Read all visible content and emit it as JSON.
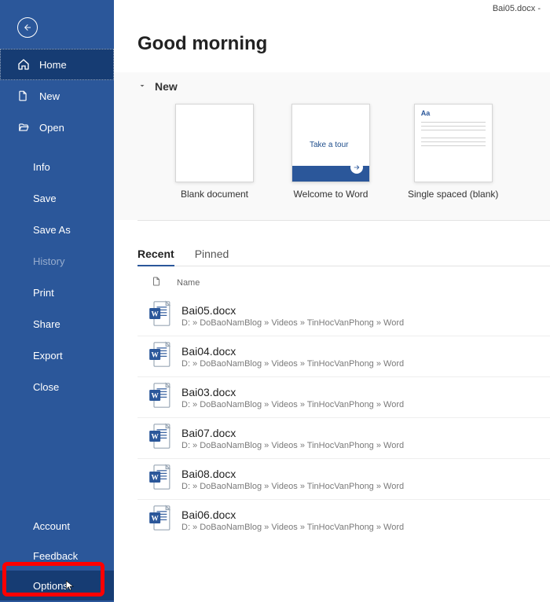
{
  "titlebar": "Bai05.docx -",
  "greeting": "Good morning",
  "new_section_label": "New",
  "sidebar": {
    "primary": [
      {
        "key": "home",
        "label": "Home",
        "icon": "home-icon",
        "active": true
      },
      {
        "key": "new",
        "label": "New",
        "icon": "page-icon"
      },
      {
        "key": "open",
        "label": "Open",
        "icon": "folder-icon"
      }
    ],
    "secondary": [
      {
        "key": "info",
        "label": "Info"
      },
      {
        "key": "save",
        "label": "Save"
      },
      {
        "key": "saveas",
        "label": "Save As"
      },
      {
        "key": "history",
        "label": "History",
        "dim": true
      },
      {
        "key": "print",
        "label": "Print"
      },
      {
        "key": "share",
        "label": "Share"
      },
      {
        "key": "export",
        "label": "Export"
      },
      {
        "key": "close",
        "label": "Close"
      }
    ],
    "bottom": [
      {
        "key": "account",
        "label": "Account"
      },
      {
        "key": "feedback",
        "label": "Feedback"
      },
      {
        "key": "options",
        "label": "Options",
        "highlighted": true
      }
    ]
  },
  "templates": [
    {
      "key": "blank",
      "label": "Blank document",
      "thumb": "blank"
    },
    {
      "key": "welcome",
      "label": "Welcome to Word",
      "thumb": "tour",
      "tour_text": "Take a tour"
    },
    {
      "key": "single",
      "label": "Single spaced (blank)",
      "thumb": "single",
      "thumb_text": "Aa"
    }
  ],
  "tabs": [
    {
      "key": "recent",
      "label": "Recent",
      "active": true
    },
    {
      "key": "pinned",
      "label": "Pinned"
    }
  ],
  "list_header": {
    "name_label": "Name"
  },
  "recent_files": [
    {
      "name": "Bai05.docx",
      "path": "D: » DoBaoNamBlog » Videos » TinHocVanPhong » Word"
    },
    {
      "name": "Bai04.docx",
      "path": "D: » DoBaoNamBlog » Videos » TinHocVanPhong » Word"
    },
    {
      "name": "Bai03.docx",
      "path": "D: » DoBaoNamBlog » Videos » TinHocVanPhong » Word"
    },
    {
      "name": "Bai07.docx",
      "path": "D: » DoBaoNamBlog » Videos » TinHocVanPhong » Word"
    },
    {
      "name": "Bai08.docx",
      "path": "D: » DoBaoNamBlog » Videos » TinHocVanPhong » Word"
    },
    {
      "name": "Bai06.docx",
      "path": "D: » DoBaoNamBlog » Videos » TinHocVanPhong » Word"
    }
  ]
}
